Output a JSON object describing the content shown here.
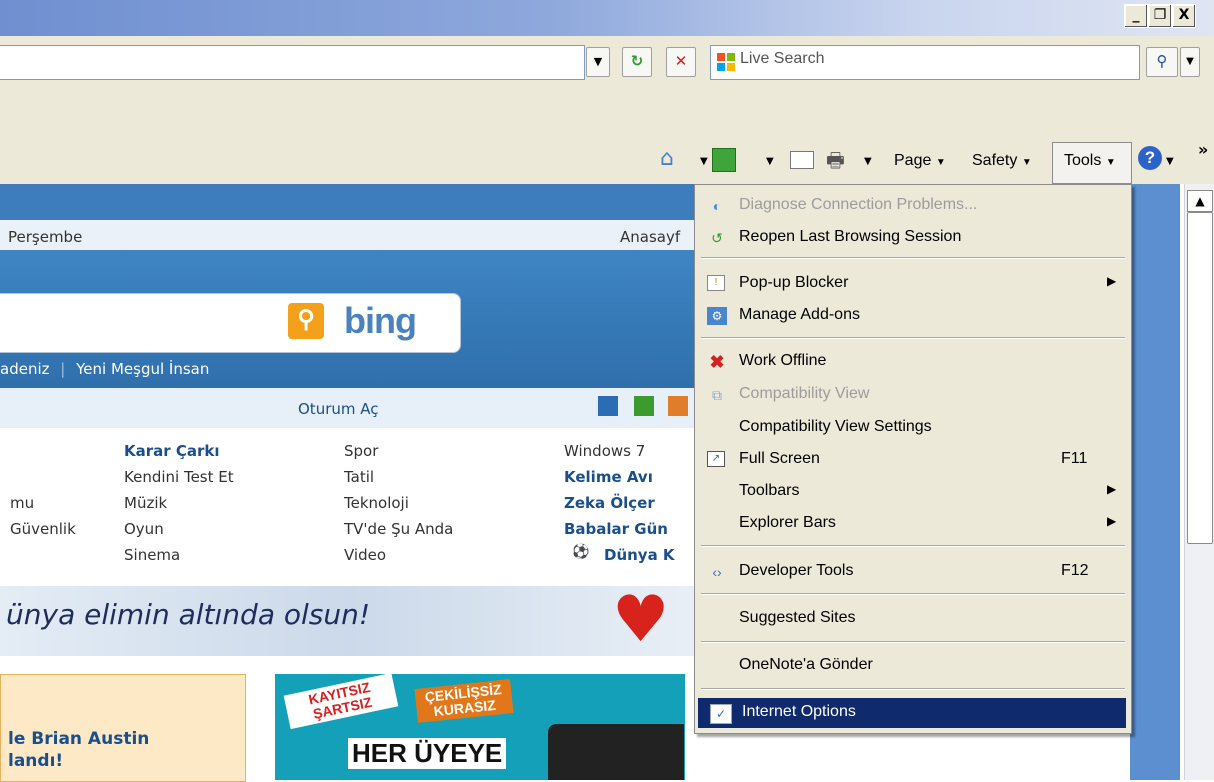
{
  "window": {
    "controls": [
      "_",
      "❐",
      "X"
    ]
  },
  "address": {
    "value": ""
  },
  "search": {
    "placeholder": "Live Search"
  },
  "commandbar": {
    "page_label": "Page",
    "safety_label": "Safety",
    "tools_label": "Tools",
    "more": "»"
  },
  "page": {
    "date": "Perşembe",
    "home_link": "Anasayf",
    "bing": "bing",
    "subnav": [
      "adeniz",
      "Yeni Meşgul İnsan"
    ],
    "login": "Oturum Aç",
    "squares": [
      "#2a6db5",
      "#3c9a2e",
      "#e07d2a"
    ],
    "col1": [
      "mu",
      "Güvenlik"
    ],
    "col2": [
      "Karar Çarkı",
      "Kendini Test Et",
      "Müzik",
      "Oyun",
      "Sinema"
    ],
    "col3": [
      "Spor",
      "Tatil",
      "Teknoloji",
      "TV'de Şu Anda",
      "Video"
    ],
    "col4": [
      "Windows 7",
      "Kelime Avı",
      "Zeka Ölçer",
      "Babalar Gün",
      "Dünya K"
    ],
    "banner": "ünya elimin altında olsun!",
    "box1_text": [
      "le Brian Austin",
      "landı!"
    ],
    "box2": {
      "tag1": "KAYITSIZ ŞARTSIZ",
      "tag2": "ÇEKİLİŞSİZ KURASIZ",
      "headline": "HER ÜYEYE"
    }
  },
  "menu": {
    "items": [
      {
        "label": "Diagnose Connection Problems...",
        "disabled": true,
        "icon": "diagnose-icon"
      },
      {
        "label": "Reopen Last Browsing Session",
        "icon": "reopen-icon"
      },
      {
        "label": "Pop-up Blocker",
        "submenu": true,
        "icon": "popup-blocker-icon"
      },
      {
        "label": "Manage Add-ons",
        "icon": "addons-icon"
      },
      {
        "label": "Work Offline",
        "icon": "offline-icon"
      },
      {
        "label": "Compatibility View",
        "disabled": true,
        "icon": "compat-view-icon"
      },
      {
        "label": "Compatibility View Settings"
      },
      {
        "label": "Full Screen",
        "shortcut": "F11",
        "icon": "fullscreen-icon"
      },
      {
        "label": "Toolbars",
        "submenu": true
      },
      {
        "label": "Explorer Bars",
        "submenu": true
      },
      {
        "label": "Developer Tools",
        "shortcut": "F12",
        "icon": "devtools-icon"
      },
      {
        "label": "Suggested Sites"
      },
      {
        "label": "OneNote'a Gönder"
      },
      {
        "label": "Internet Options",
        "highlighted": true,
        "icon": "internet-options-icon"
      }
    ]
  },
  "colors": {
    "menu_highlight": "#0f2b6e",
    "menu_bg": "#ece9d8",
    "page_blue": "#3d7cbd"
  }
}
